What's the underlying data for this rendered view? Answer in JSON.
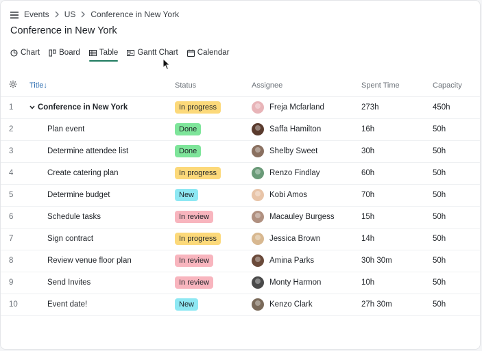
{
  "breadcrumb": {
    "items": [
      "Events",
      "US",
      "Conference in New York"
    ]
  },
  "page": {
    "title": "Conference in New York"
  },
  "views": [
    {
      "label": "Chart",
      "icon": "pie-chart-icon"
    },
    {
      "label": "Board",
      "icon": "board-icon"
    },
    {
      "label": "Table",
      "icon": "table-icon",
      "active": true
    },
    {
      "label": "Gantt Chart",
      "icon": "gantt-icon"
    },
    {
      "label": "Calendar",
      "icon": "calendar-icon"
    }
  ],
  "table": {
    "headers": {
      "title": "Title",
      "sort_indicator": "↓",
      "status": "Status",
      "assignee": "Assignee",
      "spent_time": "Spent Time",
      "capacity": "Capacity"
    },
    "rows": [
      {
        "num": "1",
        "title": "Conference in New York",
        "status": "In progress",
        "assignee": "Freja Mcfarland",
        "spent": "273h",
        "capacity": "450h"
      },
      {
        "num": "2",
        "title": "Plan event",
        "status": "Done",
        "assignee": "Saffa Hamilton",
        "spent": "16h",
        "capacity": "50h"
      },
      {
        "num": "3",
        "title": "Determine attendee list",
        "status": "Done",
        "assignee": "Shelby Sweet",
        "spent": "30h",
        "capacity": "50h"
      },
      {
        "num": "4",
        "title": "Create catering plan",
        "status": "In progress",
        "assignee": "Renzo Findlay",
        "spent": "60h",
        "capacity": "50h"
      },
      {
        "num": "5",
        "title": "Determine budget",
        "status": "New",
        "assignee": "Kobi Amos",
        "spent": "70h",
        "capacity": "50h"
      },
      {
        "num": "6",
        "title": "Schedule tasks",
        "status": "In review",
        "assignee": "Macauley Burgess",
        "spent": "15h",
        "capacity": "50h"
      },
      {
        "num": "7",
        "title": "Sign contract",
        "status": "In progress",
        "assignee": "Jessica Brown",
        "spent": "14h",
        "capacity": "50h"
      },
      {
        "num": "8",
        "title": "Review venue floor plan",
        "status": "In review",
        "assignee": "Amina Parks",
        "spent": "30h 30m",
        "capacity": "50h"
      },
      {
        "num": "9",
        "title": "Send Invites",
        "status": "In review",
        "assignee": "Monty Harmon",
        "spent": "10h",
        "capacity": "50h"
      },
      {
        "num": "10",
        "title": "Event date!",
        "status": "New",
        "assignee": "Kenzo Clark",
        "spent": "27h 30m",
        "capacity": "50h"
      }
    ]
  },
  "colors": {
    "in_progress": "#fcd97a",
    "done": "#7ee59a",
    "new": "#8ee8f3",
    "in_review": "#f8b5be",
    "accent": "#1d7a5e",
    "avatars": [
      "#e8b4b8",
      "#5a3b2e",
      "#8a7060",
      "#6a9a78",
      "#e8c4a8",
      "#b09080",
      "#d8b890",
      "#6a4a3a",
      "#4a4a4a",
      "#7a6a5a"
    ]
  }
}
